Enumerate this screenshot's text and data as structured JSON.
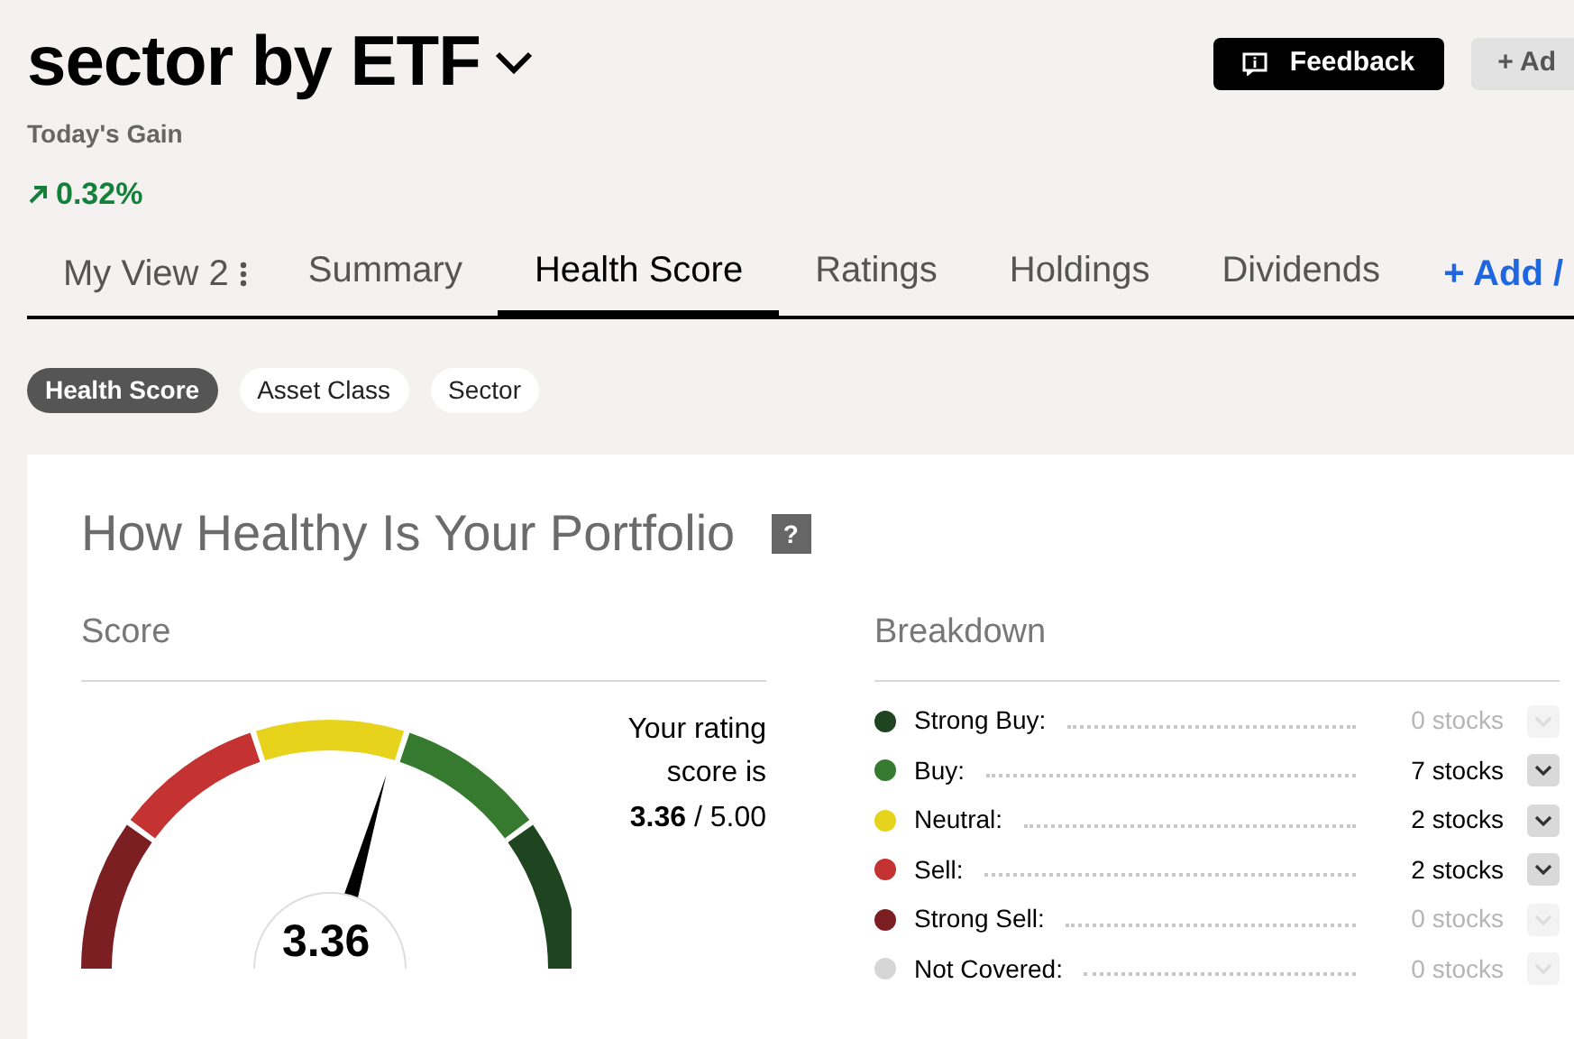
{
  "header": {
    "title": "sector by ETF",
    "gain_label": "Today's Gain",
    "gain_value": "0.32%",
    "buttons": [
      "Feedback",
      "+ Ad"
    ]
  },
  "tabs": [
    {
      "label": "My View 2",
      "selected": false,
      "kind": "menu"
    },
    {
      "label": "Summary",
      "selected": false,
      "kind": "tab"
    },
    {
      "label": "Health Score",
      "selected": true,
      "kind": "tab"
    },
    {
      "label": "Ratings",
      "selected": false,
      "kind": "tab"
    },
    {
      "label": "Holdings",
      "selected": false,
      "kind": "tab"
    },
    {
      "label": "Dividends",
      "selected": false,
      "kind": "tab"
    },
    {
      "label": "+ Add /",
      "selected": false,
      "kind": "add"
    }
  ],
  "pills": [
    {
      "label": "Health Score",
      "selected": true
    },
    {
      "label": "Asset Class",
      "selected": false
    },
    {
      "label": "Sector",
      "selected": false
    }
  ],
  "card": {
    "title": "How Healthy Is Your Portfolio",
    "help": "?",
    "score": {
      "heading": "Score",
      "value": "3.36",
      "rating_text": "Your rating score is",
      "rating_value": "3.36",
      "rating_max": "/ 5.00"
    },
    "breakdown": {
      "heading": "Breakdown",
      "rows": [
        {
          "label": "Strong Buy:",
          "count": "0 stocks",
          "color": "#1f4520",
          "disabled": true
        },
        {
          "label": "Buy:",
          "count": "7 stocks",
          "color": "#357a2e",
          "disabled": false
        },
        {
          "label": "Neutral:",
          "count": "2 stocks",
          "color": "#e8d31c",
          "disabled": false
        },
        {
          "label": "Sell:",
          "count": "2 stocks",
          "color": "#c43232",
          "disabled": false
        },
        {
          "label": "Strong Sell:",
          "count": "0 stocks",
          "color": "#7b1f22",
          "disabled": true
        },
        {
          "label": "Not Covered:",
          "count": "0 stocks",
          "color": "#d6d6d6",
          "disabled": true
        }
      ]
    }
  }
}
